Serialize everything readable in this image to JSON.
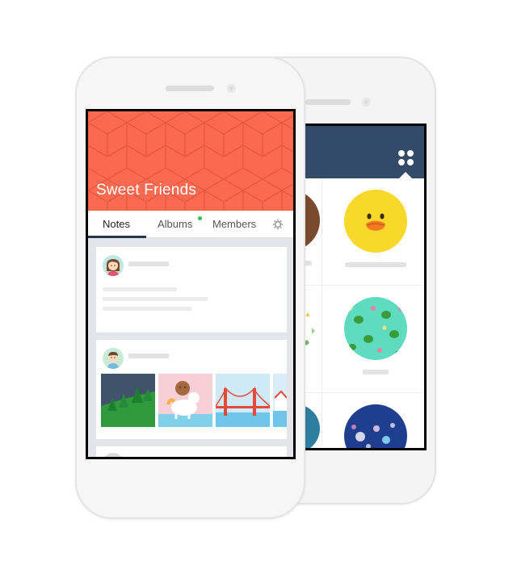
{
  "app": {
    "group_name": "Sweet Friends",
    "tabs": [
      {
        "label": "Notes",
        "active": true
      },
      {
        "label": "Albums",
        "active": false,
        "badge": true
      },
      {
        "label": "Members",
        "active": false
      }
    ]
  },
  "icons": {
    "settings": "gear-icon",
    "menu": "grid-icon"
  },
  "colors": {
    "cover": "#f96a51",
    "tab_indicator": "#24354f",
    "header_back": "#334a68",
    "badge": "#31c04c"
  }
}
